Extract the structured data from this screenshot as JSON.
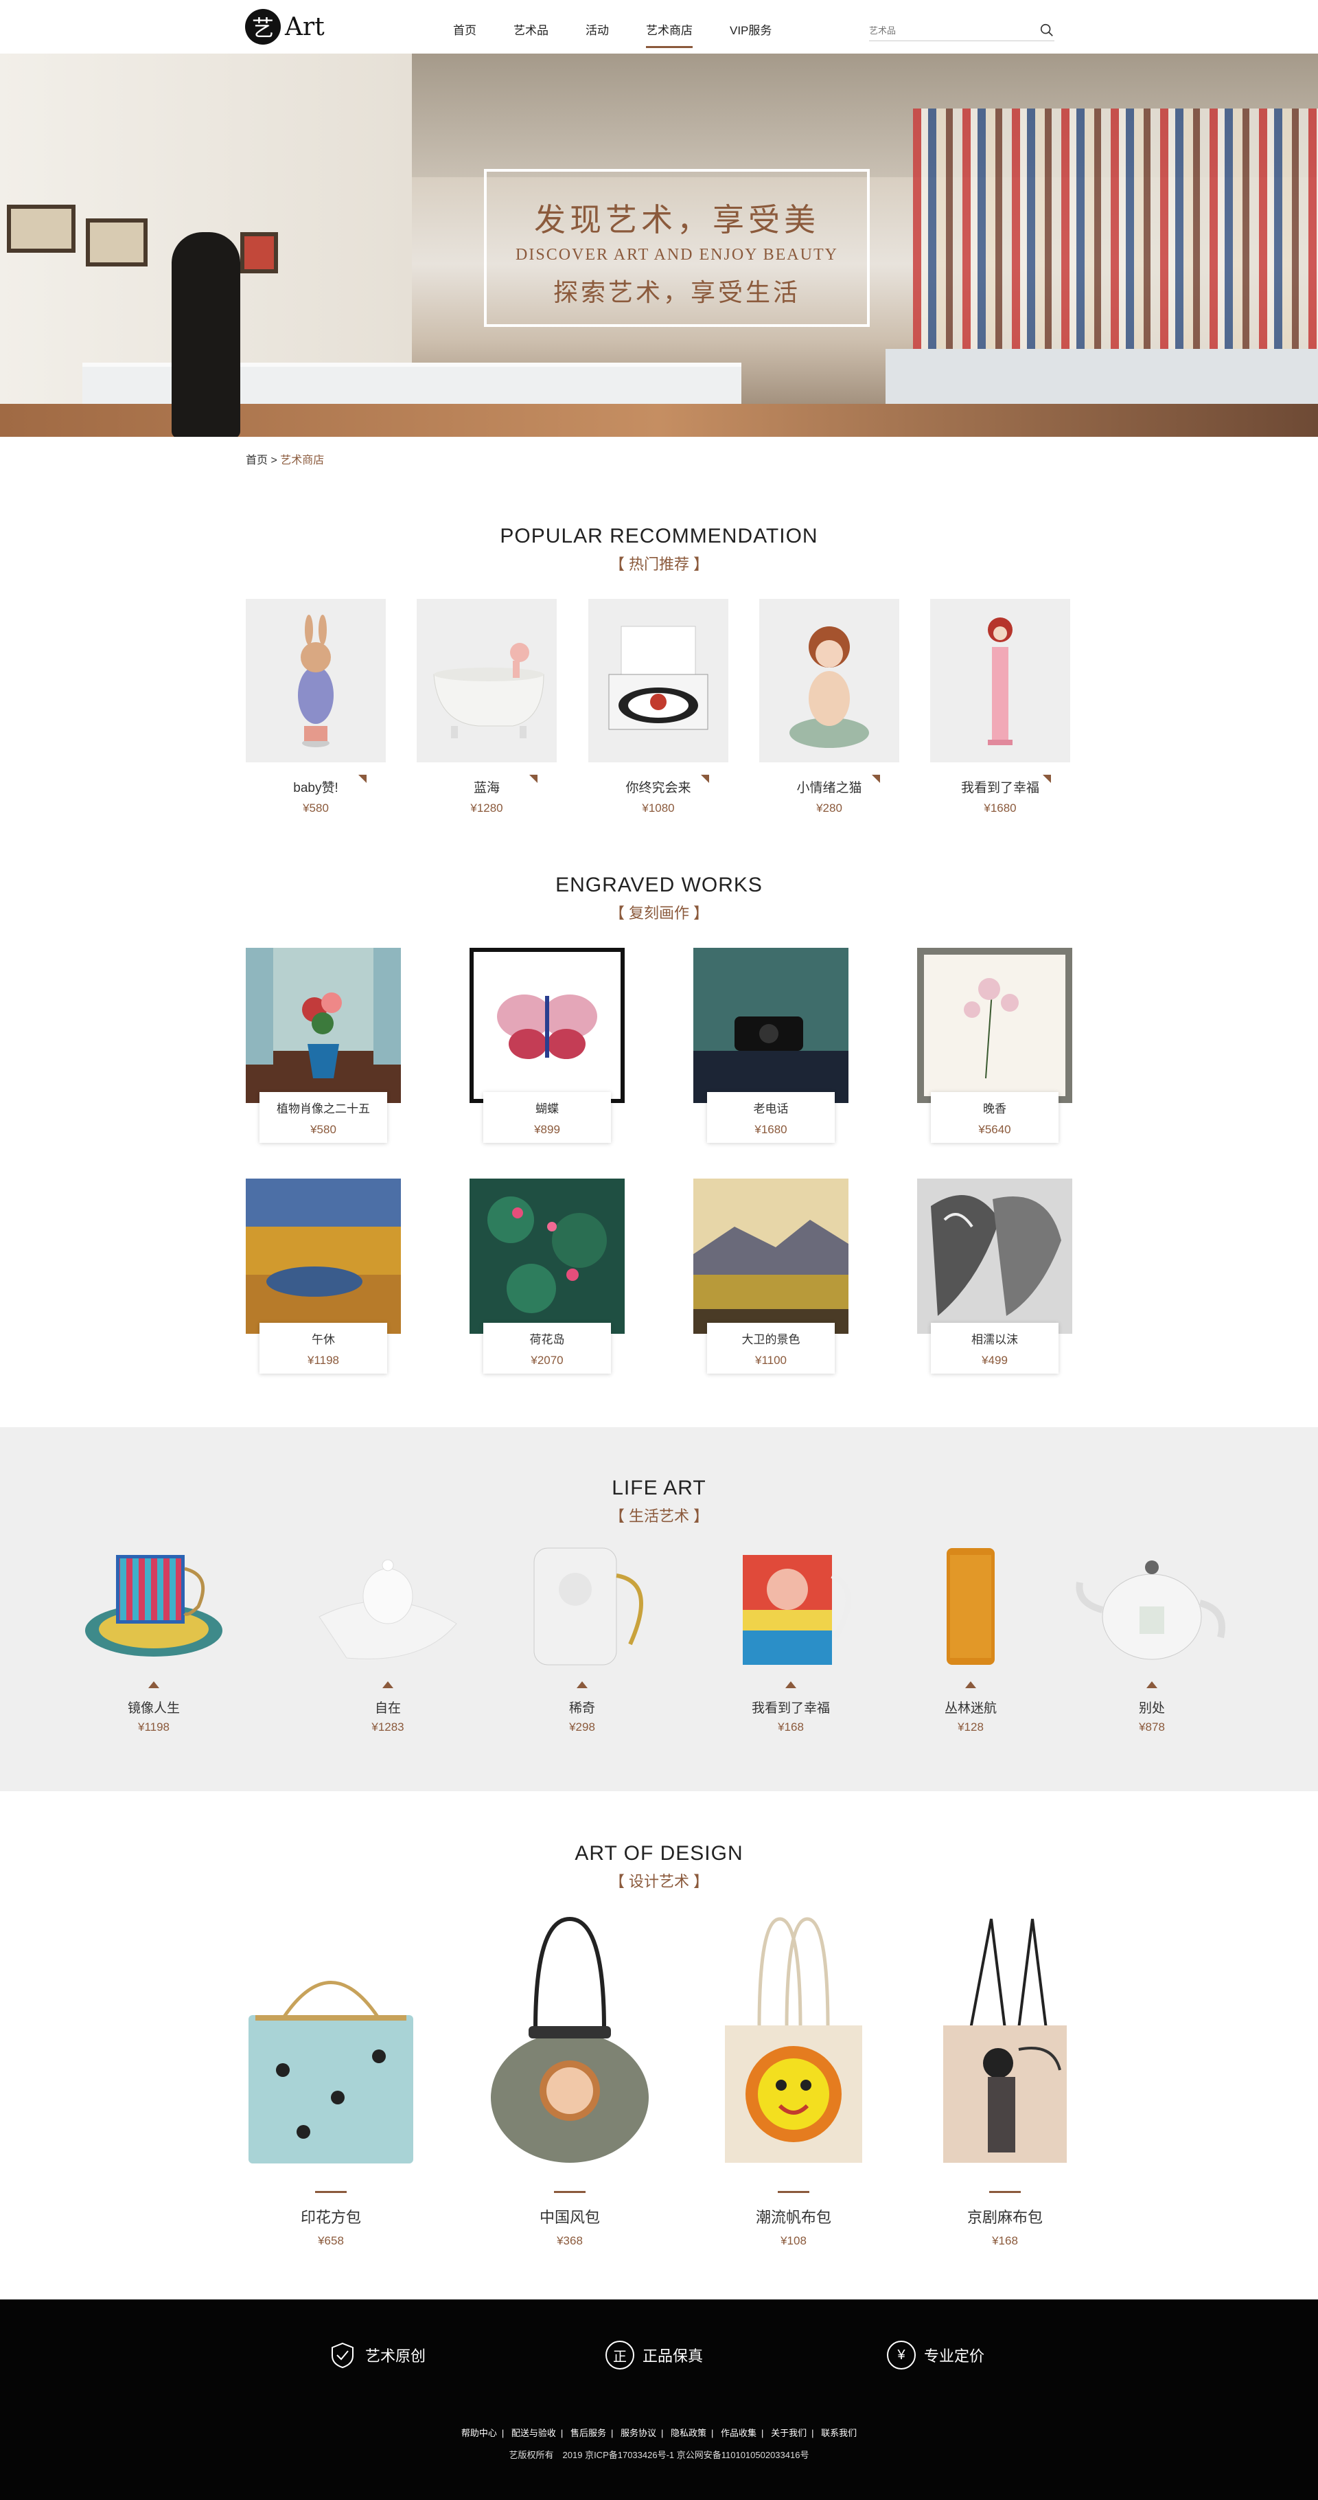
{
  "header": {
    "logo_char": "艺",
    "logo_text": "Art",
    "nav": [
      {
        "label": "首页",
        "active": false
      },
      {
        "label": "艺术品",
        "active": false
      },
      {
        "label": "活动",
        "active": false
      },
      {
        "label": "艺术商店",
        "active": true
      },
      {
        "label": "VIP服务",
        "active": false
      }
    ],
    "search_placeholder": "艺术品"
  },
  "hero": {
    "line1": "发现艺术，享受美",
    "line2": "DISCOVER ART AND ENJOY BEAUTY",
    "line3": "探索艺术，享受生活"
  },
  "breadcrumb": {
    "home": "首页",
    "sep": " > ",
    "current": "艺术商店"
  },
  "popular": {
    "title_en": "POPULAR RECOMMENDATION",
    "title_cn": "【 热门推荐 】",
    "items": [
      {
        "name": "baby赞!",
        "price": "¥580"
      },
      {
        "name": "蓝海",
        "price": "¥1280"
      },
      {
        "name": "你终究会来",
        "price": "¥1080"
      },
      {
        "name": "小情绪之猫",
        "price": "¥280"
      },
      {
        "name": "我看到了幸福",
        "price": "¥1680"
      }
    ]
  },
  "engraved": {
    "title_en": "ENGRAVED WORKS",
    "title_cn": "【 复刻画作 】",
    "items": [
      {
        "name": "植物肖像之二十五",
        "price": "¥580"
      },
      {
        "name": "蝴蝶",
        "price": "¥899"
      },
      {
        "name": "老电话",
        "price": "¥1680"
      },
      {
        "name": "晚香",
        "price": "¥5640"
      },
      {
        "name": "午休",
        "price": "¥1198"
      },
      {
        "name": "荷花岛",
        "price": "¥2070"
      },
      {
        "name": "大卫的景色",
        "price": "¥1100"
      },
      {
        "name": "相濡以沫",
        "price": "¥499"
      }
    ]
  },
  "life": {
    "title_en": "LIFE ART",
    "title_cn": "【 生活艺术 】",
    "items": [
      {
        "name": "镜像人生",
        "price": "¥1198"
      },
      {
        "name": "自在",
        "price": "¥1283"
      },
      {
        "name": "稀奇",
        "price": "¥298"
      },
      {
        "name": "我看到了幸福",
        "price": "¥168"
      },
      {
        "name": "丛林迷航",
        "price": "¥128"
      },
      {
        "name": "别处",
        "price": "¥878"
      }
    ]
  },
  "design": {
    "title_en": "ART OF DESIGN",
    "title_cn": "【 设计艺术 】",
    "items": [
      {
        "name": "印花方包",
        "price": "¥658"
      },
      {
        "name": "中国风包",
        "price": "¥368"
      },
      {
        "name": "潮流帆布包",
        "price": "¥108"
      },
      {
        "name": "京剧麻布包",
        "price": "¥168"
      }
    ]
  },
  "footer": {
    "features": [
      {
        "label": "艺术原创",
        "icon": "shield-check-icon"
      },
      {
        "label": "正品保真",
        "icon": "genuine-icon",
        "glyph": "正"
      },
      {
        "label": "专业定价",
        "icon": "yen-icon",
        "glyph": "¥"
      }
    ],
    "links": [
      "帮助中心",
      "配送与验收",
      "售后服务",
      "服务协议",
      "隐私政策",
      "作品收集",
      "关于我们",
      "联系我们"
    ],
    "copyright": "艺版权所有　2019 京ICP备17033426号-1 京公网安备11010105020334​16号"
  },
  "colors": {
    "accent": "#8b5a3c",
    "footer_bg": "#050505",
    "section_bg": "#efefef"
  }
}
